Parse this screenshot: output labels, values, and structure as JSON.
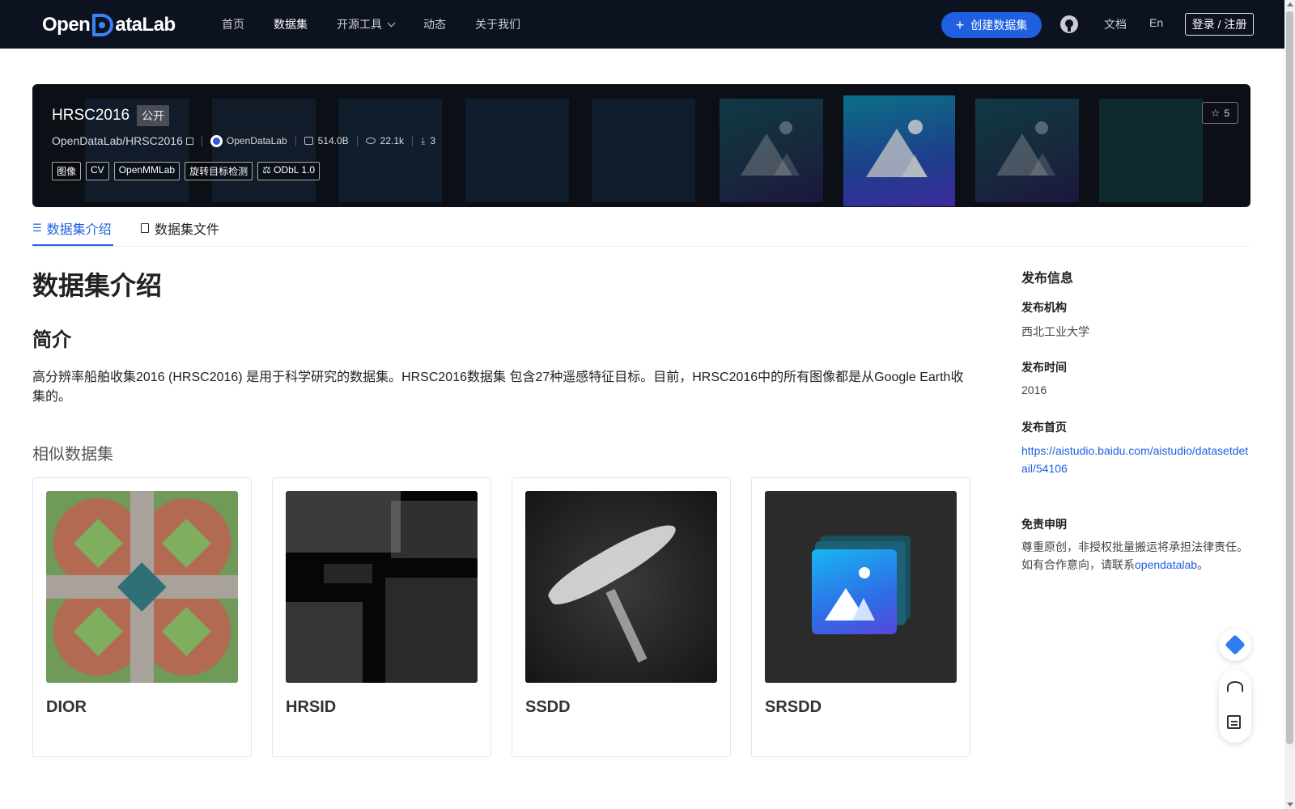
{
  "nav": {
    "logo": {
      "left": "Open",
      "right": "ataLab"
    },
    "links": [
      {
        "label": "首页",
        "active": false
      },
      {
        "label": "数据集",
        "active": true
      },
      {
        "label": "开源工具",
        "active": false,
        "dropdown": true
      },
      {
        "label": "动态",
        "active": false
      },
      {
        "label": "关于我们",
        "active": false
      }
    ],
    "create_button": "创建数据集",
    "docs": "文档",
    "lang": "En",
    "login": "登录 / 注册"
  },
  "dataset": {
    "title": "HRSC2016",
    "visibility": "公开",
    "path": "OpenDataLab/HRSC2016",
    "org": "OpenDataLab",
    "size": "514.0B",
    "views": "22.1k",
    "downloads": "3",
    "tags": [
      "图像",
      "CV",
      "OpenMMLab",
      "旋转目标检测"
    ],
    "license": "ODbL 1.0",
    "stars": "5"
  },
  "tabs": [
    {
      "label": "数据集介绍",
      "active": true
    },
    {
      "label": "数据集文件",
      "active": false
    }
  ],
  "content": {
    "heading": "数据集介绍",
    "subheading": "简介",
    "intro": "高分辨率船舶收集2016 (HRSC2016) 是用于科学研究的数据集。HRSC2016数据集 包含27种遥感特征目标。目前，HRSC2016中的所有图像都是从Google Earth收集的。",
    "similar_heading": "相似数据集",
    "similar": [
      {
        "name": "DIOR"
      },
      {
        "name": "HRSID"
      },
      {
        "name": "SSDD"
      },
      {
        "name": "SRSDD"
      }
    ]
  },
  "sidebar": {
    "title": "发布信息",
    "org_label": "发布机构",
    "org_value": "西北工业大学",
    "time_label": "发布时间",
    "time_value": "2016",
    "homepage_label": "发布首页",
    "homepage_url": "https://aistudio.baidu.com/aistudio/datasetdetail/54106",
    "disclaimer_label": "免责申明",
    "disclaimer_line1": "尊重原创，非授权批量搬运将承担法律责任。",
    "disclaimer_line2_prefix": "如有合作意向，请联系",
    "disclaimer_link": "opendatalab",
    "disclaimer_suffix": "。"
  },
  "colors": {
    "nav_bg": "#0d1221",
    "accent": "#1f5fe0",
    "banner_bg": "#0c0f15"
  }
}
